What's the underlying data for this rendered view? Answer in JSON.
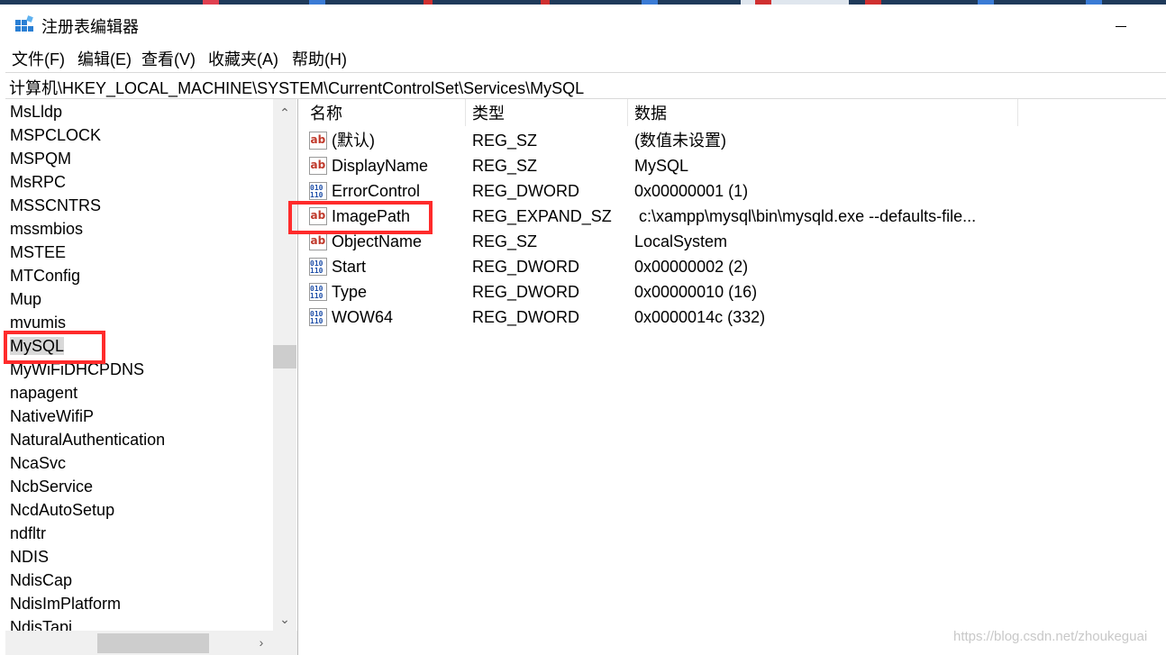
{
  "window": {
    "title": "注册表编辑器"
  },
  "menu": [
    "文件(F)",
    "编辑(E)",
    "查看(V)",
    "收藏夹(A)",
    "帮助(H)"
  ],
  "address": "计算机\\HKEY_LOCAL_MACHINE\\SYSTEM\\CurrentControlSet\\Services\\MySQL",
  "tree": {
    "items": [
      "MsLldp",
      "MSPCLOCK",
      "MSPQM",
      "MsRPC",
      "MSSCNTRS",
      "mssmbios",
      "MSTEE",
      "MTConfig",
      "Mup",
      "mvumis",
      "MySQL",
      "MyWiFiDHCPDNS",
      "napagent",
      "NativeWifiP",
      "NaturalAuthentication",
      "NcaSvc",
      "NcbService",
      "NcdAutoSetup",
      "ndfltr",
      "NDIS",
      "NdisCap",
      "NdisImPlatform",
      "NdisTapi"
    ],
    "selected": "MySQL"
  },
  "values": {
    "headers": [
      "名称",
      "类型",
      "数据"
    ],
    "rows": [
      {
        "icon": "string-value-icon",
        "name": "(默认)",
        "type": "REG_SZ",
        "data": "(数值未设置)"
      },
      {
        "icon": "string-value-icon",
        "name": "DisplayName",
        "type": "REG_SZ",
        "data": "MySQL"
      },
      {
        "icon": "binary-value-icon",
        "name": "ErrorControl",
        "type": "REG_DWORD",
        "data": "0x00000001 (1)"
      },
      {
        "icon": "string-value-icon",
        "name": "ImagePath",
        "type": "REG_EXPAND_SZ",
        "data": "c:\\xampp\\mysql\\bin\\mysqld.exe --defaults-file..."
      },
      {
        "icon": "string-value-icon",
        "name": "ObjectName",
        "type": "REG_SZ",
        "data": "LocalSystem"
      },
      {
        "icon": "binary-value-icon",
        "name": "Start",
        "type": "REG_DWORD",
        "data": "0x00000002 (2)"
      },
      {
        "icon": "binary-value-icon",
        "name": "Type",
        "type": "REG_DWORD",
        "data": "0x00000010 (16)"
      },
      {
        "icon": "binary-value-icon",
        "name": "WOW64",
        "type": "REG_DWORD",
        "data": "0x0000014c (332)"
      }
    ]
  },
  "colors": {
    "highlight": "#ff2b2b",
    "selection": "#d9d9d9",
    "taskbar": "#1f3a5a"
  },
  "watermark": "https://blog.csdn.net/zhoukeguai"
}
